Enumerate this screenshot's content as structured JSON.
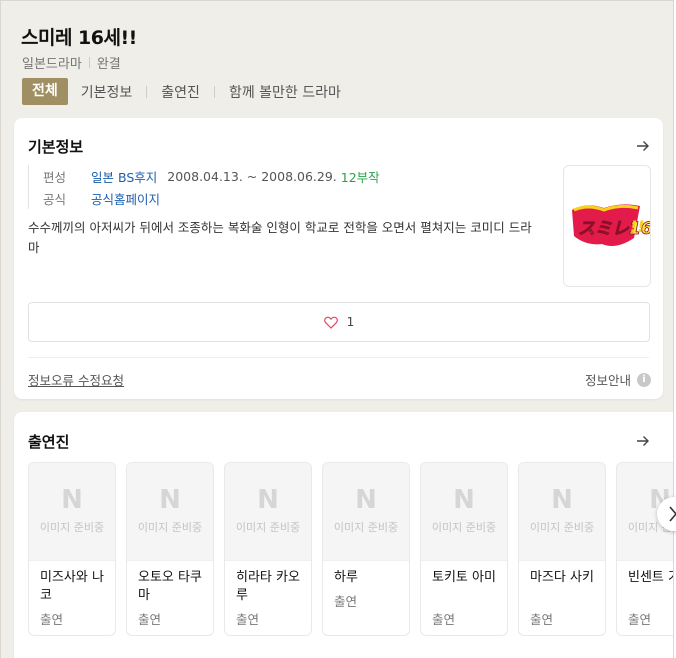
{
  "header": {
    "title": "스미레 16세!!",
    "genre": "일본드라마",
    "status": "완결"
  },
  "tabs": [
    {
      "label": "전체",
      "active": true
    },
    {
      "label": "기본정보"
    },
    {
      "label": "출연진"
    },
    {
      "label": "함께 볼만한 드라마"
    }
  ],
  "basic_info": {
    "title": "기본정보",
    "broadcast_key": "편성",
    "broadcast_channel": "일본 BS후지",
    "broadcast_period": "2008.04.13. ~ 2008.06.29.",
    "episodes": "12부작",
    "official_key": "공식",
    "official_link": "공식홈페이지",
    "description": "수수께끼의 아저씨가 뒤에서 조종하는 복화술 인형이 학교로 전학을 오면서 펼쳐지는 코미디 드라마",
    "poster_text": "スミレ16",
    "like_count": "1",
    "report_link": "정보오류 수정요청",
    "guide_label": "정보안내",
    "guide_icon": "i"
  },
  "cast": {
    "title": "출연진",
    "no_image_text": "이미지 준비중",
    "placeholder_logo": "N",
    "members": [
      {
        "name": "미즈사와 나코",
        "role": "출연"
      },
      {
        "name": "오토오 타쿠마",
        "role": "출연"
      },
      {
        "name": "히라타 카오루",
        "role": "출연"
      },
      {
        "name": "하루",
        "role": "출연"
      },
      {
        "name": "토키토 아미",
        "role": "출연"
      },
      {
        "name": "마즈다 사키",
        "role": "출연"
      },
      {
        "name": "빈센트 기리",
        "role": "출연"
      }
    ]
  },
  "colors": {
    "accent": "#9f8f62",
    "link": "#1b5fb0",
    "episodes": "#2aa44a",
    "background": "#efeee8"
  }
}
